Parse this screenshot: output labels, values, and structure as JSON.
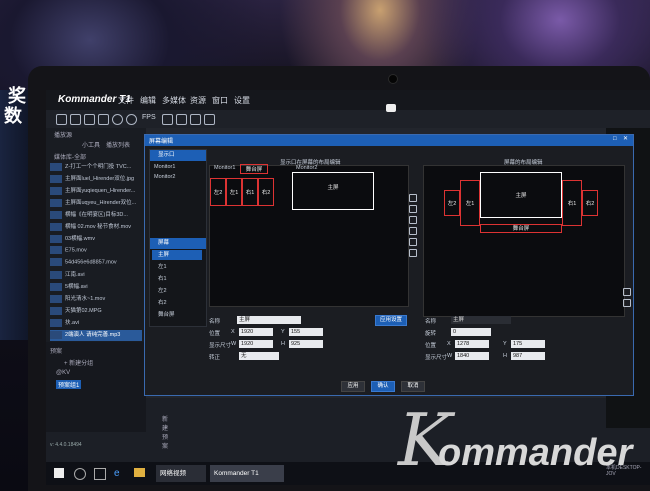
{
  "app": {
    "title": "Kommander T1"
  },
  "menu": [
    "文件",
    "编辑",
    "多媒体",
    "资源",
    "窗口",
    "设置"
  ],
  "toolbar": {
    "fps_label": "FPS"
  },
  "left_panel": {
    "tabs": [
      "播放源",
      "小工具",
      "播放列表"
    ],
    "section": "媒体库-全部",
    "items": [
      "Z-打工一个个明门投 TVC...",
      "主屏面luel_Hirender双位.jpg",
      "主屏面yuqiequen_Hirender...",
      "主屏面uqyeu_Hirender双位...",
      "横幅《在明宴区)目标3D...",
      "横幅 02.mov  秘节食材.mov",
      "03横幅.wmv",
      "E75.mov",
      "54d456e6d8857.mov",
      "江南.avi",
      "5横幅.avi",
      "阳光清水~1.mov",
      "天猫第02.MPG",
      "扶.avi",
      "2端演人 请纯完善.mp3"
    ]
  },
  "playlist": {
    "title": "预案",
    "new_group": "+ 新建分组",
    "groups": [
      "@KV",
      "预案组1"
    ],
    "new_plan": "新建预案"
  },
  "dialog": {
    "title": "屏幕编辑",
    "screen_list_tab": "显示口",
    "monitors": [
      "Monitor1",
      "Monitor2"
    ],
    "screens_tab": "屏幕",
    "screens": [
      "主屏",
      "左1",
      "右1",
      "左2",
      "右2",
      "舞台屏"
    ],
    "left_view_caption": "显示口在屏幕的布局编辑",
    "right_view_caption": "屏幕的布局编辑",
    "left_view": {
      "monitor1": "Monitor1",
      "monitor2": "Monitor2",
      "stage": "舞台屏",
      "main": "主屏",
      "left1": "左1",
      "left2": "左2",
      "right1": "右1",
      "right2": "右2"
    },
    "right_view": {
      "main": "主屏",
      "left1": "左1",
      "left2": "左2",
      "right1": "右1",
      "right2": "右2",
      "stage": "舞台屏"
    },
    "left_props": {
      "name_label": "名称",
      "name_value": "主屏",
      "position_label": "位置",
      "x_label": "X",
      "x": "1920",
      "y_label": "Y",
      "y": "155",
      "size_label": "显示尺寸",
      "w_label": "W",
      "w": "1920",
      "h_label": "H",
      "h": "925",
      "rotate_label": "转正",
      "rotate_value": "无",
      "apply_btn": "应用设置"
    },
    "right_props": {
      "name_label": "名称",
      "name_value": "主屏",
      "rotate_label": "旋转",
      "rotate_value": "0",
      "position_label": "位置",
      "x_label": "X",
      "x": "1278",
      "y_label": "Y",
      "y": "175",
      "size_label": "显示尺寸",
      "w_label": "W",
      "w": "1840",
      "h_label": "H",
      "h": "987"
    },
    "buttons": {
      "apply": "应用",
      "ok": "确认",
      "cancel": "取消"
    }
  },
  "statusbar": {
    "version": "v: 4.4.0.18494"
  },
  "taskbar": {
    "apps": [
      "网络视频",
      "Kommander T1"
    ],
    "machine": "本机DESKTOP-JOV"
  },
  "brand": {
    "k": "K",
    "rest": "ommander"
  },
  "sidewall_text": [
    "奖",
    "数"
  ]
}
